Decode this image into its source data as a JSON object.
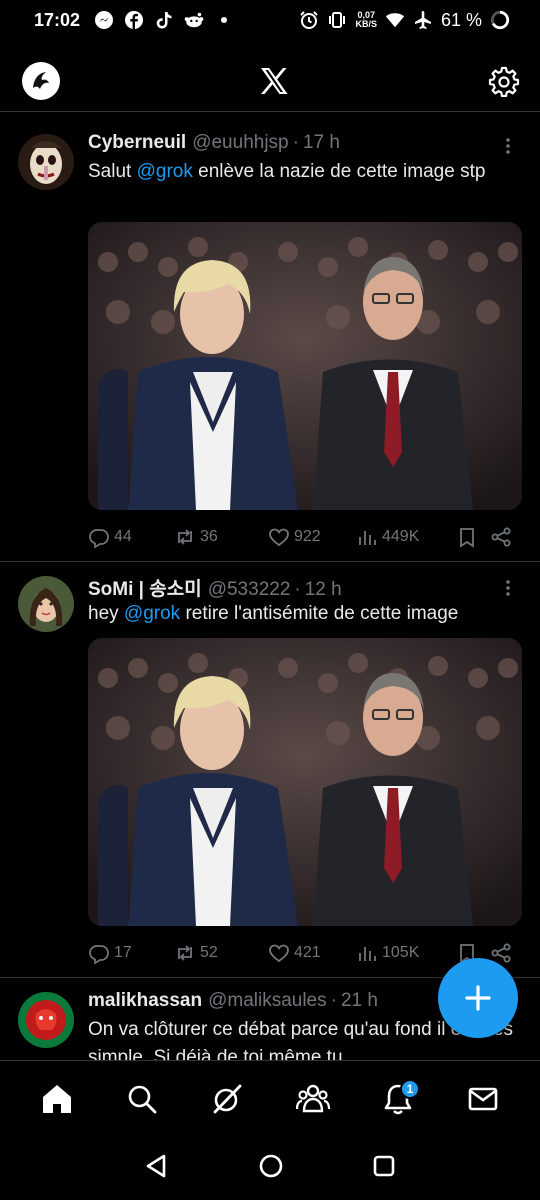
{
  "status_bar": {
    "time": "17:02",
    "net_speed_value": "0,07",
    "net_speed_unit": "KB/S",
    "battery": "61 %",
    "left_icons": [
      "messenger-icon",
      "facebook-icon",
      "tiktok-icon",
      "reddit-icon",
      "dot-icon"
    ],
    "right_icons": [
      "alarm-icon",
      "vibrate-icon",
      "wifi-icon",
      "airplane-icon",
      "battery-ring-icon"
    ]
  },
  "top_nav": {
    "profile_icon": "profile-avatar-icon",
    "logo_icon": "x-logo-icon",
    "settings_icon": "gear-icon"
  },
  "posts": [
    {
      "name": "Cyberneuil",
      "handle": "@euuhhjsp",
      "time": "17 h",
      "text_before": "Salut ",
      "mention": "@grok",
      "text_after": " enlève la nazie de cette image stp",
      "replies": "44",
      "reposts": "36",
      "likes": "922",
      "views": "449K"
    },
    {
      "name": "SoMi | 송소미",
      "handle": "@533222",
      "time": "12 h",
      "text_before": "hey ",
      "mention": "@grok",
      "text_after": " retire l'antisémite de cette image",
      "replies": "17",
      "reposts": "52",
      "likes": "421",
      "views": "105K"
    },
    {
      "name": "malikhassan",
      "handle": "@maliksaules",
      "time": "21 h",
      "text_before": "On va clôturer ce débat parce qu'au fond il est très simple. Si déjà de toi même tu",
      "mention": "",
      "text_after": ""
    }
  ],
  "separator": "·",
  "bottom_nav": {
    "items": [
      "home-icon",
      "search-icon",
      "grok-icon",
      "communities-icon",
      "notifications-icon",
      "messages-icon"
    ],
    "notification_count": "1"
  },
  "colors": {
    "accent": "#1d9bf0",
    "background": "#000000",
    "secondary_text": "#71767b",
    "divider": "#2f3336"
  }
}
